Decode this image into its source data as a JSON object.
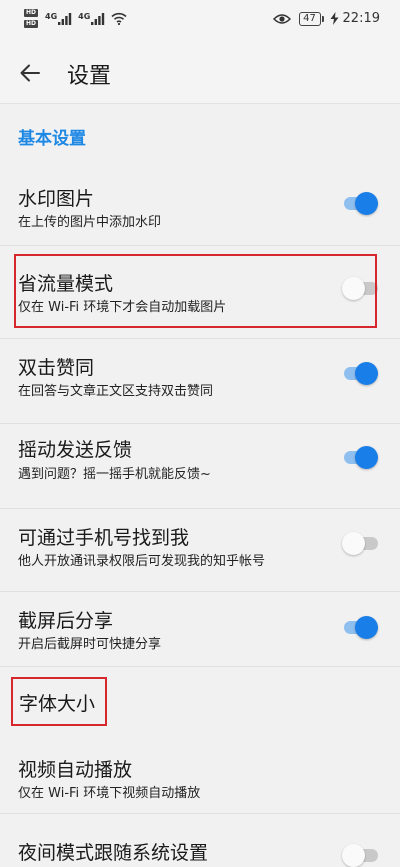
{
  "status_bar": {
    "sim_badges": [
      "HD",
      "HD"
    ],
    "signal_labels": [
      "4G",
      "4G"
    ],
    "battery": "47",
    "time": "22:19"
  },
  "header": {
    "title": "设置"
  },
  "sections": {
    "basic": "基本设置",
    "font_size": "字体大小"
  },
  "settings": [
    {
      "title": "水印图片",
      "subtitle": "在上传的图片中添加水印",
      "enabled": true
    },
    {
      "title": "省流量模式",
      "subtitle": "仅在 Wi-Fi 环境下才会自动加载图片",
      "enabled": false
    },
    {
      "title": "双击赞同",
      "subtitle": "在回答与文章正文区支持双击赞同",
      "enabled": true
    },
    {
      "title": "摇动发送反馈",
      "subtitle": "遇到问题？摇一摇手机就能反馈~",
      "enabled": true
    },
    {
      "title": "可通过手机号找到我",
      "subtitle": "他人开放通讯录权限后可发现我的知乎帐号",
      "enabled": false
    },
    {
      "title": "截屏后分享",
      "subtitle": "开启后截屏时可快捷分享",
      "enabled": true
    }
  ],
  "video_autoplay": {
    "title": "视频自动播放",
    "subtitle": "仅在 Wi-Fi 环境下视频自动播放"
  },
  "night_mode": {
    "title": "夜间模式跟随系统设置",
    "enabled": false
  },
  "colors": {
    "accent": "#1e88e5",
    "toggle_on": "#1a7ee8",
    "highlight_box": "#d6262e"
  }
}
